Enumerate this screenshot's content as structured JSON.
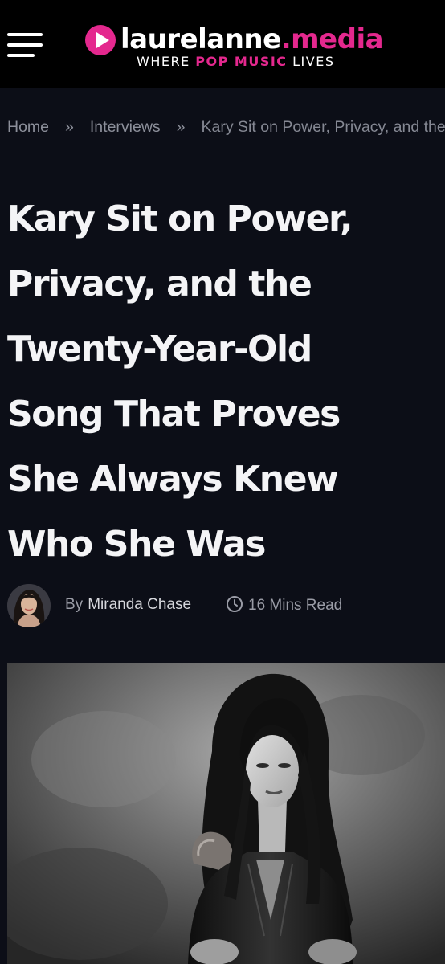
{
  "header": {
    "logo_name_white": "laurelanne",
    "logo_name_pink": ".media",
    "tagline_before": "WHERE ",
    "tagline_highlight": "POP MUSIC",
    "tagline_after": " LIVES",
    "menu_icon": "hamburger-menu-icon",
    "play_icon": "play-circle-icon",
    "brand_color": "#e4288e",
    "background_color": "#000000"
  },
  "breadcrumb": {
    "items": [
      "Home",
      "Interviews"
    ],
    "separator": "»",
    "current": "Kary Sit on Power, Privacy, and the"
  },
  "article": {
    "title_lines": [
      "Kary Sit on Power,",
      "Privacy, and the",
      "Twenty-Year-Old",
      "Song That Proves",
      "She Always Knew",
      "Who She Was"
    ],
    "by_prefix": "By",
    "author": "Miranda Chase",
    "read_time": "16 Mins Read",
    "read_time_icon": "clock-icon",
    "hero_image": "black-and-white portrait photo"
  },
  "colors": {
    "page_background": "#0c0e17",
    "title_text": "#f4f4f6",
    "muted_text": "#8c8f9a"
  }
}
